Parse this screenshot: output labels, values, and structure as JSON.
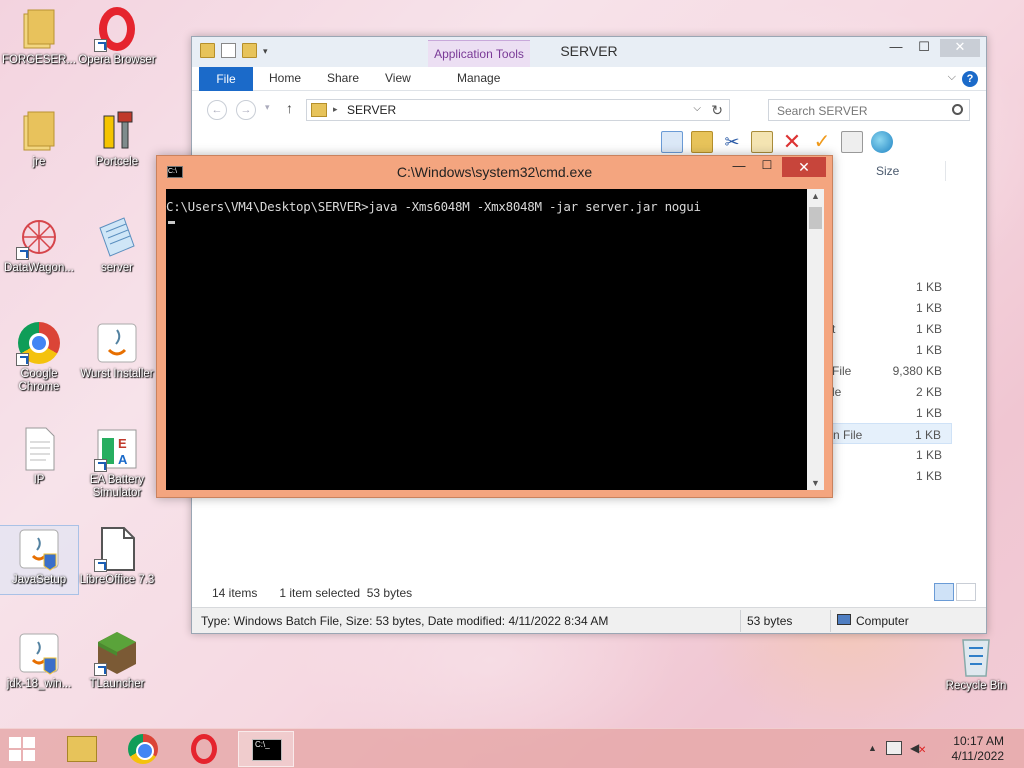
{
  "desktop": {
    "icons": [
      {
        "label": "FORGESER..."
      },
      {
        "label": "Opera Browser"
      },
      {
        "label": "jre"
      },
      {
        "label": "Portcele"
      },
      {
        "label": "DataWagon..."
      },
      {
        "label": "server"
      },
      {
        "label": "Google Chrome"
      },
      {
        "label": "Wurst Installer"
      },
      {
        "label": "IP"
      },
      {
        "label": "EA Battery Simulator"
      },
      {
        "label": "JavaSetup"
      },
      {
        "label": "LibreOffice 7.3"
      },
      {
        "label": "jdk-18_win..."
      },
      {
        "label": "TLauncher"
      },
      {
        "label": "Recycle Bin"
      }
    ]
  },
  "explorer": {
    "title": "SERVER",
    "app_tools_label": "Application Tools",
    "tabs": {
      "file": "File",
      "home": "Home",
      "share": "Share",
      "view": "View",
      "manage": "Manage"
    },
    "address": "SERVER",
    "search_placeholder": "Search SERVER",
    "size_header": "Size",
    "rows": [
      {
        "type": "",
        "size": "1 KB"
      },
      {
        "type": "",
        "size": "1 KB"
      },
      {
        "type": "t",
        "size": "1 KB"
      },
      {
        "type": "",
        "size": "1 KB"
      },
      {
        "type": "File",
        "size": "9,380 KB"
      },
      {
        "type": "le",
        "size": "2 KB"
      },
      {
        "type": "",
        "size": "1 KB"
      },
      {
        "type": "n File",
        "size": "1 KB"
      },
      {
        "type": "",
        "size": "1 KB"
      },
      {
        "type": "",
        "size": "1 KB"
      }
    ],
    "status": {
      "items": "14 items",
      "selected": "1 item selected",
      "selected_size": "53 bytes"
    },
    "details": {
      "main": "Type: Windows Batch File, Size: 53 bytes, Date modified: 4/11/2022 8:34 AM",
      "size": "53 bytes",
      "location": "Computer"
    }
  },
  "cmd": {
    "title": "C:\\Windows\\system32\\cmd.exe",
    "line1": "C:\\Users\\VM4\\Desktop\\SERVER>java -Xms6048M -Xmx8048M -jar server.jar nogui"
  },
  "taskbar": {
    "time": "10:17 AM",
    "date": "4/11/2022"
  },
  "colors": {
    "accent": "#1b6ac9",
    "cmd_frame": "#f4a57f",
    "taskbar": "#e5a5a5"
  }
}
